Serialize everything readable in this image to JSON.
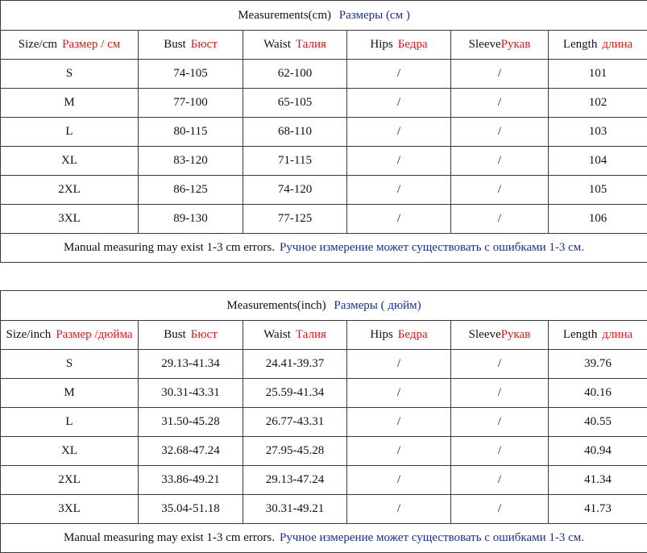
{
  "colors": {
    "russian_header": "#e01515",
    "russian_note": "#1a2f8c",
    "border": "#3a3a3a"
  },
  "cm_table": {
    "title_en": "Measurements(cm)",
    "title_ru": "Размеры (см )",
    "headers": [
      {
        "en": "Size/cm",
        "ru": "Размер / см"
      },
      {
        "en": "Bust",
        "ru": "Бюст"
      },
      {
        "en": "Waist",
        "ru": "Талия"
      },
      {
        "en": "Hips",
        "ru": "Бедра"
      },
      {
        "en": "Sleeve",
        "ru": "Рукав"
      },
      {
        "en": "Length",
        "ru": "длина"
      }
    ],
    "rows": [
      [
        "S",
        "74-105",
        "62-100",
        "/",
        "/",
        "101"
      ],
      [
        "M",
        "77-100",
        "65-105",
        "/",
        "/",
        "102"
      ],
      [
        "L",
        "80-115",
        "68-110",
        "/",
        "/",
        "103"
      ],
      [
        "XL",
        "83-120",
        "71-115",
        "/",
        "/",
        "104"
      ],
      [
        "2XL",
        "86-125",
        "74-120",
        "/",
        "/",
        "105"
      ],
      [
        "3XL",
        "89-130",
        "77-125",
        "/",
        "/",
        "106"
      ]
    ],
    "note_en": "Manual measuring may exist 1-3 cm errors.",
    "note_ru": "Ручное измерение может существовать с ошибками 1-3 см."
  },
  "inch_table": {
    "title_en": "Measurements(inch)",
    "title_ru": "Размеры ( дюйм)",
    "headers": [
      {
        "en": "Size/inch",
        "ru": "Размер /дюйма"
      },
      {
        "en": "Bust",
        "ru": "Бюст"
      },
      {
        "en": "Waist",
        "ru": "Талия"
      },
      {
        "en": "Hips",
        "ru": "Бедра"
      },
      {
        "en": "Sleeve",
        "ru": "Рукав"
      },
      {
        "en": "Length",
        "ru": "длина"
      }
    ],
    "rows": [
      [
        "S",
        "29.13-41.34",
        "24.41-39.37",
        "/",
        "/",
        "39.76"
      ],
      [
        "M",
        "30.31-43.31",
        "25.59-41.34",
        "/",
        "/",
        "40.16"
      ],
      [
        "L",
        "31.50-45.28",
        "26.77-43.31",
        "/",
        "/",
        "40.55"
      ],
      [
        "XL",
        "32.68-47.24",
        "27.95-45.28",
        "/",
        "/",
        "40.94"
      ],
      [
        "2XL",
        "33.86-49.21",
        "29.13-47.24",
        "/",
        "/",
        "41.34"
      ],
      [
        "3XL",
        "35.04-51.18",
        "30.31-49.21",
        "/",
        "/",
        "41.73"
      ]
    ],
    "note_en": "Manual measuring may exist 1-3 cm errors.",
    "note_ru": "Ручное измерение может существовать с ошибками 1-3 см."
  }
}
